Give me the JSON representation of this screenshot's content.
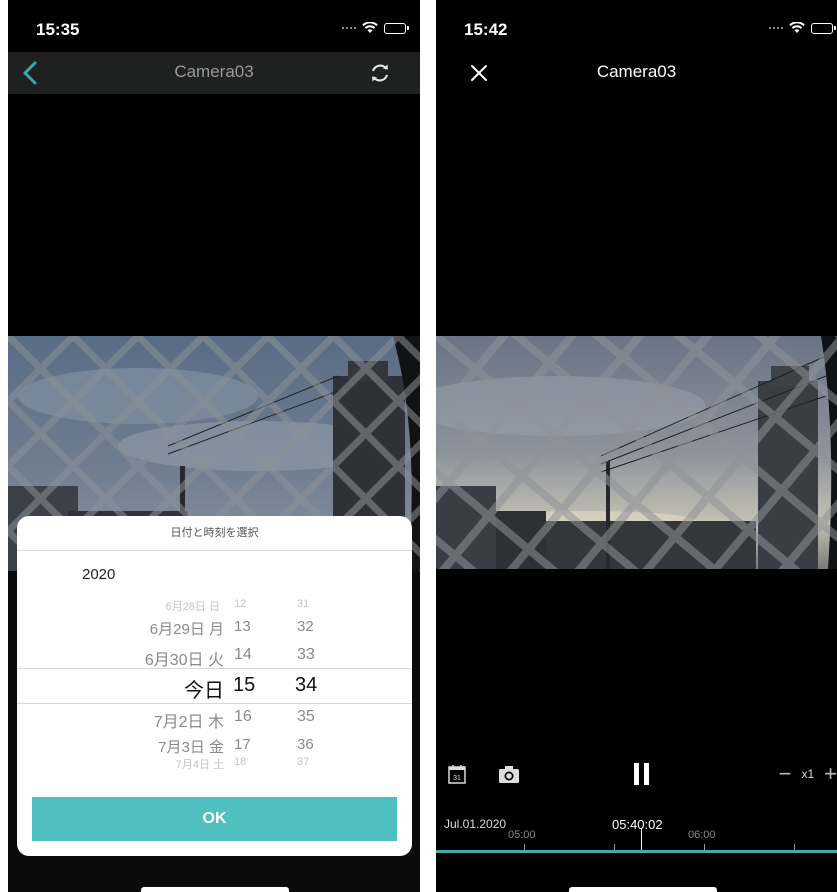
{
  "left": {
    "status_time": "15:35",
    "title": "Camera03",
    "picker": {
      "header": "日付と時刻を選択",
      "year": "2020",
      "rows": [
        {
          "date": "6月28日 日",
          "hour": "12",
          "minute": "31"
        },
        {
          "date": "6月29日 月",
          "hour": "13",
          "minute": "32"
        },
        {
          "date": "6月30日 火",
          "hour": "14",
          "minute": "33"
        },
        {
          "date": "今日",
          "hour": "15",
          "minute": "34"
        },
        {
          "date": "7月2日 木",
          "hour": "16",
          "minute": "35"
        },
        {
          "date": "7月3日 金",
          "hour": "17",
          "minute": "36"
        },
        {
          "date": "7月4日 土",
          "hour": "18",
          "minute": "37"
        }
      ],
      "ok_label": "OK"
    }
  },
  "right": {
    "status_time": "15:42",
    "title": "Camera03",
    "zoom": {
      "minus": "−",
      "level": "x1",
      "plus": "+"
    },
    "timeline": {
      "date": "Jul.01.2020",
      "current_time": "05:40:02",
      "tick_labels": [
        "05:00",
        "06:00"
      ]
    }
  },
  "colors": {
    "accent": "#4fbfc0",
    "back_arrow": "#3aa7ad"
  },
  "icons": [
    "back-arrow-icon",
    "refresh-icon",
    "close-icon",
    "calendar-icon",
    "camera-icon",
    "pause-icon",
    "wifi-icon",
    "battery-icon"
  ]
}
